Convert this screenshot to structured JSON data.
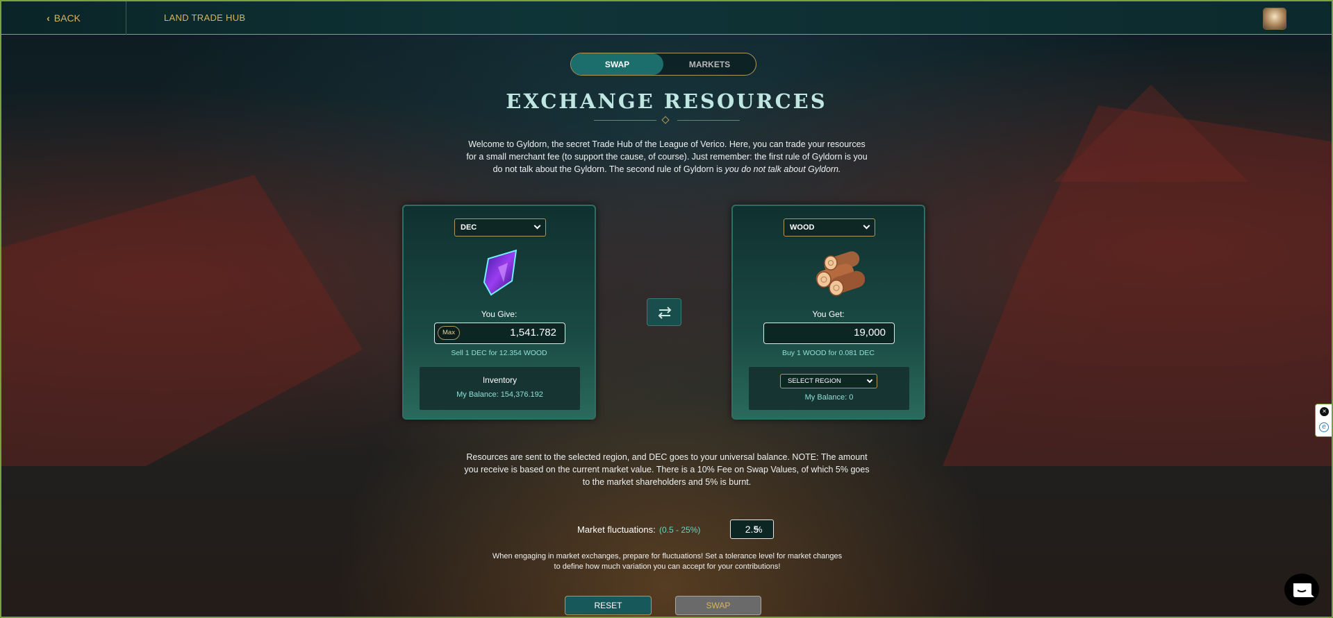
{
  "header": {
    "back_label": "BACK",
    "title": "LAND TRADE HUB"
  },
  "tabs": [
    {
      "label": "SWAP",
      "active": true
    },
    {
      "label": "MARKETS",
      "active": false
    }
  ],
  "page": {
    "title": "EXCHANGE RESOURCES",
    "intro_main": "Welcome to Gyldorn, the secret Trade Hub of the League of Verico. Here, you can trade your resources for a small merchant fee (to support the cause, of course). Just remember: the first rule of Gyldorn is you do not talk about the Gyldorn. The second rule of Gyldorn is ",
    "intro_italic": "you do not talk about Gyldorn."
  },
  "give": {
    "token": "DEC",
    "label": "You Give:",
    "max_label": "Max",
    "amount": "1,541.782",
    "rate": "Sell 1 DEC for 12.354 WOOD",
    "inventory_title": "Inventory",
    "balance": "My Balance: 154,376.192"
  },
  "get": {
    "token": "WOOD",
    "label": "You Get:",
    "amount": "19,000",
    "rate": "Buy 1 WOOD for 0.081 DEC",
    "region_label": "SELECT REGION",
    "balance": "My Balance: 0"
  },
  "notes": {
    "info": "Resources are sent to the selected region, and DEC goes to your universal balance. NOTE: The amount you receive is based on the current market value. There is a 10% Fee on Swap Values, of which 5% goes to the market shareholders and 5% is burnt.",
    "fluct_label": "Market fluctuations:",
    "fluct_range": "(0.5 - 25%)",
    "fluct_value": "2.5",
    "fluct_unit": "%",
    "hint": "When engaging in market exchanges, prepare for fluctuations! Set a tolerance level for market changes to define how much variation you can accept for your contributions!"
  },
  "actions": {
    "reset_label": "RESET",
    "swap_label": "SWAP"
  },
  "colors": {
    "accent_gold": "#d9b45c",
    "teal": "#1b6e6c",
    "rate_text": "#8fe0d6"
  }
}
